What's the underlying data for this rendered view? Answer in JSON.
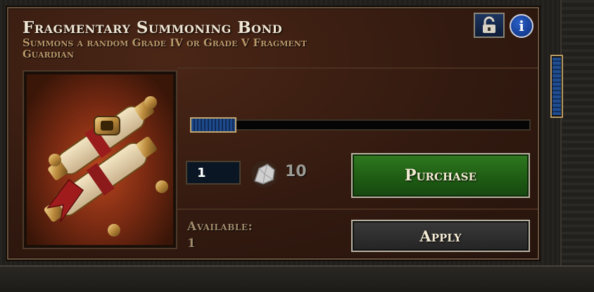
{
  "item": {
    "title": "Fragmentary Summoning Bond",
    "subtitle": "Summons a random Grade IV or Grade V Fragment Guardian",
    "image_icon": "summoning-scroll-icon"
  },
  "header_buttons": {
    "lock_icon": "padlock-open-icon",
    "info_icon": "info-icon",
    "info_glyph": "i"
  },
  "purchase": {
    "quantity": "1",
    "price": "10",
    "currency_icon": "stone-shard-icon",
    "purchase_label": "Purchase",
    "apply_label": "Apply",
    "slider_fraction": 0.1
  },
  "availability": {
    "label": "Available:",
    "value": "1"
  },
  "colors": {
    "panel": "#331a10",
    "purchase_button": "#1f5d14",
    "apply_button": "#2a2a2a",
    "title_text": "#f0e6d4",
    "subtitle_text": "#b8966a"
  }
}
